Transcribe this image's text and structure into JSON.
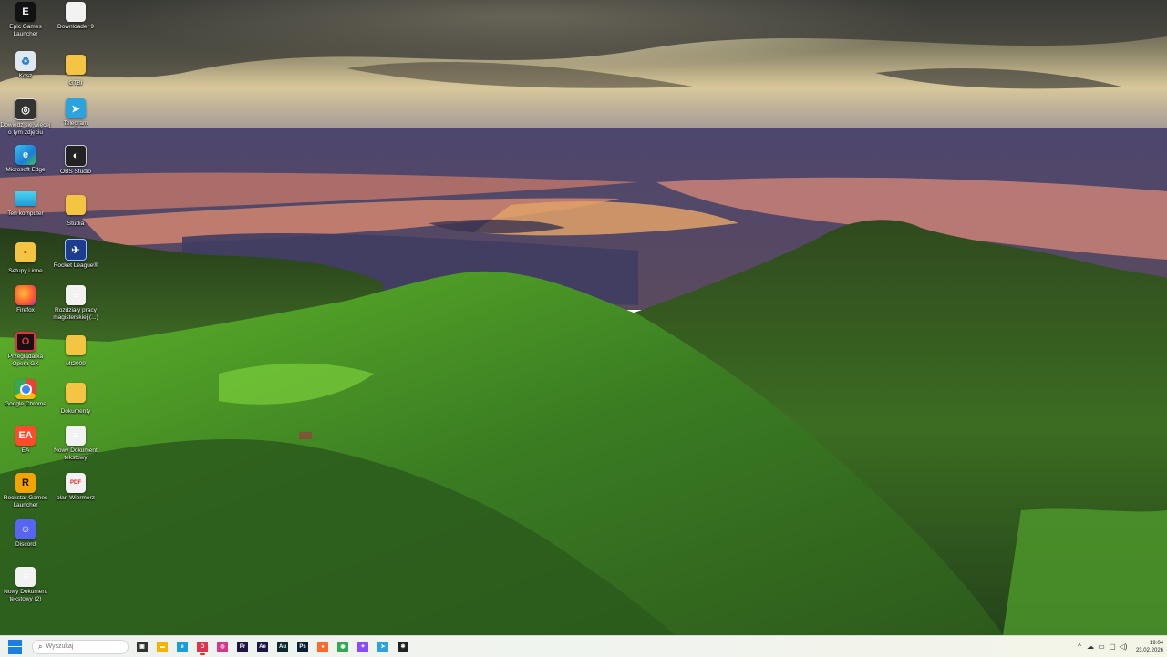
{
  "desktop": {
    "icons": [
      {
        "label": "Epic Games Launcher",
        "icon": "epic-games-icon"
      },
      {
        "label": "Kosz",
        "icon": "recycle-bin-icon"
      },
      {
        "label": "Dowiedz się więcej o tym zdjęciu",
        "icon": "camera-icon"
      },
      {
        "label": "Microsoft Edge",
        "icon": "edge-icon"
      },
      {
        "label": "Ten komputer",
        "icon": "computer-icon"
      },
      {
        "label": "Setupy i inne",
        "icon": "folder-icon"
      },
      {
        "label": "Firefox",
        "icon": "firefox-icon"
      },
      {
        "label": "Przeglądarka Opera GX",
        "icon": "opera-gx-icon"
      },
      {
        "label": "Google Chrome",
        "icon": "chrome-icon"
      },
      {
        "label": "EA",
        "icon": "ea-icon"
      },
      {
        "label": "Rockstar Games Launcher",
        "icon": "rockstar-icon"
      },
      {
        "label": "Discord",
        "icon": "discord-icon"
      },
      {
        "label": "Nowy Dokument tekstowy (2)",
        "icon": "text-file-icon"
      },
      {
        "label": "Downloader 9",
        "icon": "file-icon"
      },
      {
        "label": "GTBI",
        "icon": "folder-icon"
      },
      {
        "label": "Telegram",
        "icon": "telegram-icon"
      },
      {
        "label": "OBS Studio",
        "icon": "obs-icon"
      },
      {
        "label": "Studia",
        "icon": "folder-icon"
      },
      {
        "label": "Rocket League®",
        "icon": "rocket-league-icon"
      },
      {
        "label": "Rozdziały pracy magisterskiej (...)",
        "icon": "text-file-icon"
      },
      {
        "label": "Mt2009",
        "icon": "folder-icon"
      },
      {
        "label": "Dokumenty",
        "icon": "folder-icon"
      },
      {
        "label": "Nowy Dokument tekstowy",
        "icon": "text-file-icon"
      },
      {
        "label": "plan Wiermerz",
        "icon": "pdf-icon"
      }
    ]
  },
  "taskbar": {
    "search_placeholder": "Wyszukaj",
    "apps": [
      {
        "name": "task-view",
        "icon": "task-view-icon",
        "glyph": "▣",
        "color": "#333333"
      },
      {
        "name": "file-explorer",
        "icon": "folder-icon",
        "glyph": "▬",
        "color": "#f4b400"
      },
      {
        "name": "edge",
        "icon": "edge-icon",
        "glyph": "e",
        "color": "#1a9ed8"
      },
      {
        "name": "opera-gx",
        "icon": "opera-gx-icon",
        "glyph": "O",
        "color": "#e0334b"
      },
      {
        "name": "instagram",
        "icon": "instagram-icon",
        "glyph": "◎",
        "color": "#d6388c"
      },
      {
        "name": "premiere-pro",
        "icon": "premiere-icon",
        "glyph": "Pr",
        "color": "#1e1446"
      },
      {
        "name": "after-effects",
        "icon": "after-effects-icon",
        "glyph": "Ae",
        "color": "#1e1446"
      },
      {
        "name": "audition",
        "icon": "audition-icon",
        "glyph": "Au",
        "color": "#0a2a30"
      },
      {
        "name": "photoshop",
        "icon": "photoshop-icon",
        "glyph": "Ps",
        "color": "#0a1f33"
      },
      {
        "name": "firefox",
        "icon": "firefox-icon",
        "glyph": "●",
        "color": "#ff6a2b"
      },
      {
        "name": "chrome",
        "icon": "chrome-icon",
        "glyph": "◉",
        "color": "#34a853"
      },
      {
        "name": "messenger",
        "icon": "messenger-icon",
        "glyph": "✦",
        "color": "#8a4bff"
      },
      {
        "name": "telegram",
        "icon": "telegram-icon",
        "glyph": "➤",
        "color": "#2aa3de"
      },
      {
        "name": "app-unknown",
        "icon": "app-icon",
        "glyph": "✱",
        "color": "#222222"
      }
    ],
    "clock": {
      "time": "19:04",
      "date": "23.02.2026"
    }
  },
  "colors": {
    "accent": "#1b7fe0"
  }
}
